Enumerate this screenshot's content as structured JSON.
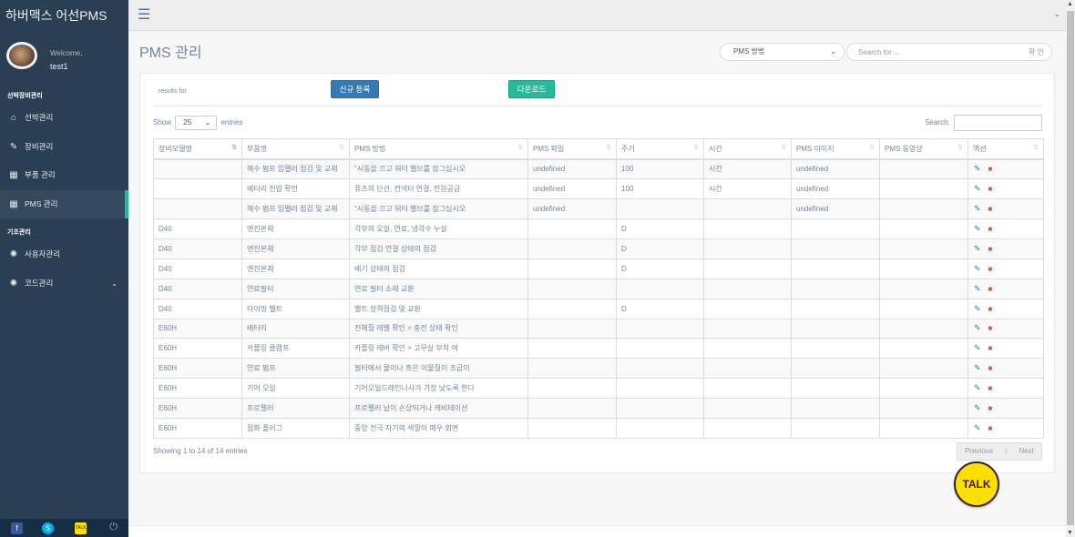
{
  "brand": {
    "title": "하버맥스 어선PMS"
  },
  "profile": {
    "welcome": "Welcome,",
    "username": "test1"
  },
  "sidebar": {
    "sections": [
      {
        "title": "선박장비관리",
        "items": [
          {
            "label": "선박관리",
            "icon": "home-icon"
          },
          {
            "label": "장비관리",
            "icon": "edit-icon"
          },
          {
            "label": "부품 관리",
            "icon": "table-icon"
          },
          {
            "label": "PMS 관리",
            "icon": "table-icon",
            "active": true
          }
        ]
      },
      {
        "title": "기초관리",
        "items": [
          {
            "label": "사용자관리",
            "icon": "bug-icon"
          },
          {
            "label": "코드관리",
            "icon": "bug-icon",
            "has_submenu": true
          }
        ]
      }
    ]
  },
  "page": {
    "title": "PMS 관리",
    "filter_select": "PMS 방법",
    "search_placeholder": "Search for ...",
    "search_button": "확 인"
  },
  "panel": {
    "results_for": "results for",
    "new_button": "신규 등록",
    "download_button": "다운로드",
    "show_label": "Show",
    "page_length": "25",
    "entries_label": "entries",
    "search_label": "Search:"
  },
  "table": {
    "headers": [
      "장비모델명",
      "부품명",
      "PMS 방법",
      "PMS 파일",
      "주기",
      "시간",
      "PMS 이미지",
      "PMS 동영상",
      "액션"
    ],
    "rows": [
      [
        "",
        "해수 펌프 임펠러 점검 및 교체",
        "\"시동을 끄고 워터 밸브를 잠그십시오",
        "undefined",
        "100",
        "시간",
        "undefined",
        ""
      ],
      [
        "",
        "배터리 전압 확인",
        "퓨즈의 단선, 컨넥터 연결, 전원공급",
        "undefined",
        "100",
        "시간",
        "undefined",
        ""
      ],
      [
        "",
        "해수 펌프 임펠러 점검 및 교체",
        "\"시동을 끄고 워터 밸브를 잠그십시오",
        "undefined",
        "",
        "",
        "undefined",
        ""
      ],
      [
        "D40",
        "엔진본체",
        "각부의 오일, 연료, 냉각수 누설",
        "",
        "D",
        "",
        "",
        ""
      ],
      [
        "D40",
        "엔진본체",
        "각부 점검 연결 상태의 점검",
        "",
        "D",
        "",
        "",
        ""
      ],
      [
        "D40",
        "엔진본체",
        "배기 상태의 점검",
        "",
        "D",
        "",
        "",
        ""
      ],
      [
        "D40",
        "연료필터",
        "연료 필터 소제 교환",
        "",
        "",
        "",
        "",
        ""
      ],
      [
        "D40",
        "타이밍 벨트",
        "벨트 장력점검 및 교환",
        "",
        "D",
        "",
        "",
        ""
      ],
      [
        "E60H",
        "배터리",
        "전해질 레벨 확인 > 충전 상태 확인",
        "",
        "",
        "",
        "",
        ""
      ],
      [
        "E60H",
        "카플링 클램프",
        "카플링 레버 확인 > 고무실 부착 여",
        "",
        "",
        "",
        "",
        ""
      ],
      [
        "E60H",
        "연료 펌프",
        "필터에서 물이나 혹은 이물질이 조금이",
        "",
        "",
        "",
        "",
        ""
      ],
      [
        "E60H",
        "기어 오일",
        "기어오일드레인나사가 가장 낮도록 한다",
        "",
        "",
        "",
        "",
        ""
      ],
      [
        "E60H",
        "프로펠러",
        "프로펠러 날이 손상되거나 캐비테이션",
        "",
        "",
        "",
        "",
        ""
      ],
      [
        "E60H",
        "점화 플러그",
        "중앙 전극 자기의 색깔이 매우 회면",
        "",
        "",
        "",
        "",
        ""
      ]
    ]
  },
  "footer": {
    "showing": "Showing 1 to 14 of 14 entries",
    "previous": "Previous",
    "page": "1",
    "next": "Next"
  },
  "talk_button": "TALK",
  "colors": {
    "sidebar": "#2a3f54",
    "accent": "#1abb9c",
    "primary": "#337ab7",
    "success": "#26b99a",
    "danger": "#d9534f"
  }
}
